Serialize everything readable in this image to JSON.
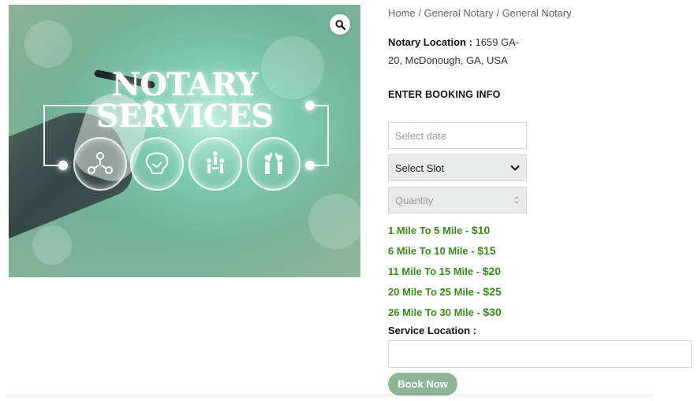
{
  "image": {
    "title_line1": "NOTARY",
    "title_line2": "SERVICES",
    "zoom_icon": "magnifier-icon"
  },
  "breadcrumb": {
    "items": [
      "Home",
      "General Notary",
      "General Notary"
    ],
    "separator": "/"
  },
  "location": {
    "label": "Notary Location :",
    "value": "1659 GA-20, McDonough, GA, USA"
  },
  "booking": {
    "heading": "ENTER BOOKING INFO",
    "date_placeholder": "Select date",
    "slot_value": "Select Slot",
    "quantity_placeholder": "Quantity"
  },
  "prices": [
    {
      "range": "1 Mile To 5 Mile - ",
      "amount": "$10"
    },
    {
      "range": "6 Mile To 10 Mile - ",
      "amount": "$15"
    },
    {
      "range": "11 Mile To 15 Mile - ",
      "amount": "$20"
    },
    {
      "range": "20 Mile To 25 Mile - ",
      "amount": "$25"
    },
    {
      "range": "26 Mile To 30 Mile - ",
      "amount": "$30"
    }
  ],
  "service": {
    "label": "Service Location :",
    "value": ""
  },
  "actions": {
    "book_label": "Book Now"
  },
  "colors": {
    "price_green": "#3a8b1c",
    "button_green": "#8fb599",
    "field_gray": "#e9ebeb"
  }
}
